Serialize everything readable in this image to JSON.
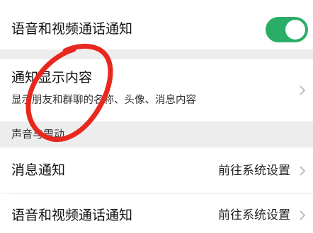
{
  "voice_video_call_notification_top": {
    "label": "语音和视频通话通知",
    "toggle_on": true
  },
  "notification_display_content": {
    "label": "通知显示内容",
    "description": "显示朋友和群聊的名称、头像、消息内容"
  },
  "sound_and_vibration_section": {
    "header": "声音与震动"
  },
  "message_notification": {
    "label": "消息通知",
    "value": "前往系统设置"
  },
  "voice_video_call_notification_bottom": {
    "label": "语音和视频通话通知",
    "value": "前往系统设置"
  },
  "colors": {
    "toggle_on": "#2aae67",
    "annotation_red": "#e8281e",
    "page_background": "#ededed"
  },
  "icons": {
    "chevron": "chevron-right-icon"
  }
}
